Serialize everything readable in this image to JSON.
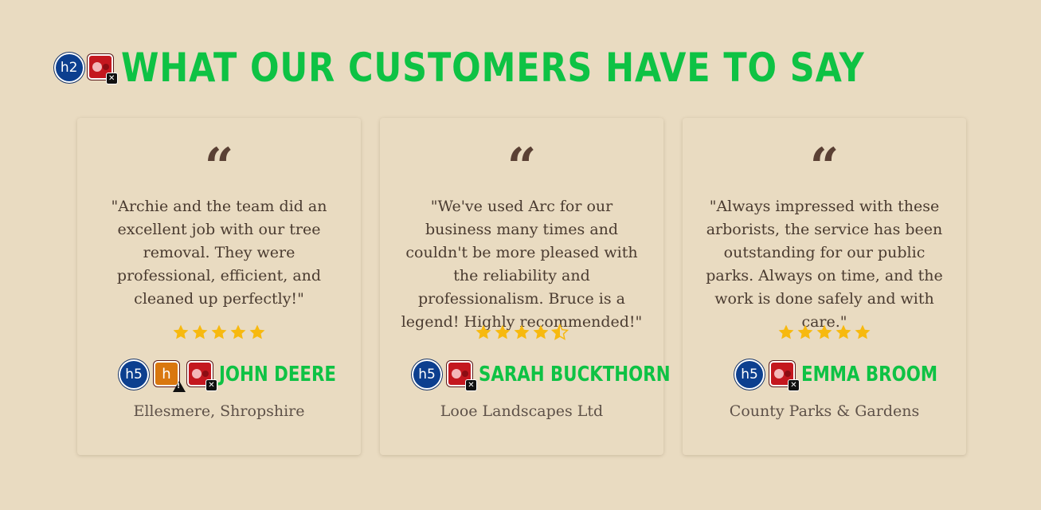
{
  "section": {
    "title": "WHAT OUR CUSTOMERS HAVE TO SAY",
    "badges": [
      {
        "icon": "h2-heading-icon",
        "label": "h2",
        "color": "#0c3f8f"
      },
      {
        "icon": "red-broken-image-icon",
        "status": "error",
        "color": "#c4171f"
      }
    ],
    "title_color": "#0ec244",
    "background": "#e9dbc1"
  },
  "testimonials": [
    {
      "quote_mark": "“",
      "quote": "\"Archie and the team did an excellent job with our tree removal. They were professional, efficient, and cleaned up perfectly!\"",
      "rating": 5,
      "name": "JOHN DEERE",
      "organisation": "Ellesmere, Shropshire",
      "badges": [
        {
          "icon": "h5-heading-icon",
          "label": "h5"
        },
        {
          "icon": "orange-link-warning-icon",
          "label": "h",
          "status": "warning"
        },
        {
          "icon": "red-broken-image-icon",
          "status": "error"
        }
      ]
    },
    {
      "quote_mark": "“",
      "quote": "\"We've used Arc for our business many times and couldn't be more pleased with the reliability and professionalism. Bruce is a legend! Highly recommended!\"",
      "rating": 4.5,
      "name": "SARAH BUCKTHORN",
      "organisation": "Looe Landscapes Ltd",
      "badges": [
        {
          "icon": "h5-heading-icon",
          "label": "h5"
        },
        {
          "icon": "red-broken-image-icon",
          "status": "error"
        }
      ]
    },
    {
      "quote_mark": "“",
      "quote": "\"Always impressed with these arborists, the service has been outstanding for our public parks. Always on time, and the work is done safely and with care.\"",
      "rating": 5,
      "name": "EMMA BROOM",
      "organisation": "County Parks & Gardens",
      "badges": [
        {
          "icon": "h5-heading-icon",
          "label": "h5"
        },
        {
          "icon": "red-broken-image-icon",
          "status": "error"
        }
      ]
    }
  ],
  "colors": {
    "star": "#f7b90f",
    "name": "#0ec244",
    "quote_mark": "#5a4034",
    "text": "#4a3b30"
  }
}
